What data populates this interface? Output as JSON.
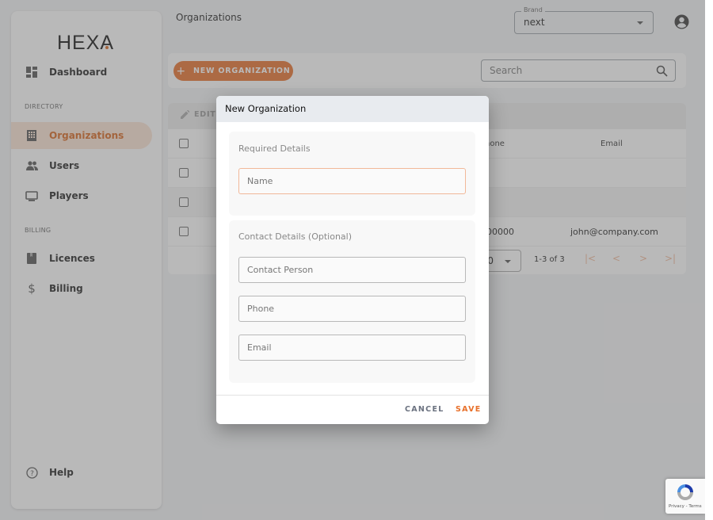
{
  "app": {
    "logo": "HEXA",
    "page_title": "Organizations",
    "brand_color": "#e8702a"
  },
  "sidebar": {
    "items": [
      {
        "label": "Dashboard",
        "icon": "dashboard-icon",
        "active": false
      },
      {
        "label": "Organizations",
        "icon": "building-icon",
        "active": true
      },
      {
        "label": "Users",
        "icon": "users-icon",
        "active": false
      },
      {
        "label": "Players",
        "icon": "monitor-icon",
        "active": false
      },
      {
        "label": "Licences",
        "icon": "book-icon",
        "active": false
      },
      {
        "label": "Billing",
        "icon": "dollar-icon",
        "active": false
      }
    ],
    "sections": [
      "DIRECTORY",
      "BILLING"
    ],
    "help_label": "Help"
  },
  "header": {
    "brand_label": "Brand",
    "brand_value": "next"
  },
  "toolbar": {
    "new_button": "NEW ORGANIZATION",
    "search_placeholder": "Search"
  },
  "table": {
    "edit_label": "EDIT",
    "columns": [
      "Phone",
      "Email"
    ],
    "visible_header_fragment": "hone",
    "rows": [
      {
        "phone": "",
        "email": ""
      },
      {
        "phone": "",
        "email": ""
      },
      {
        "phone": "00000",
        "email": "john@company.com"
      }
    ],
    "rows_per_page": "0",
    "range": "1-3 of 3"
  },
  "dialog": {
    "title": "New Organization",
    "required_section": "Required Details",
    "name_placeholder": "Name",
    "contact_section": "Contact Details (Optional)",
    "contact_person_placeholder": "Contact Person",
    "phone_placeholder": "Phone",
    "email_placeholder": "Email",
    "cancel_label": "CANCEL",
    "save_label": "SAVE"
  },
  "recaptcha": {
    "text": "Privacy - Terms"
  }
}
